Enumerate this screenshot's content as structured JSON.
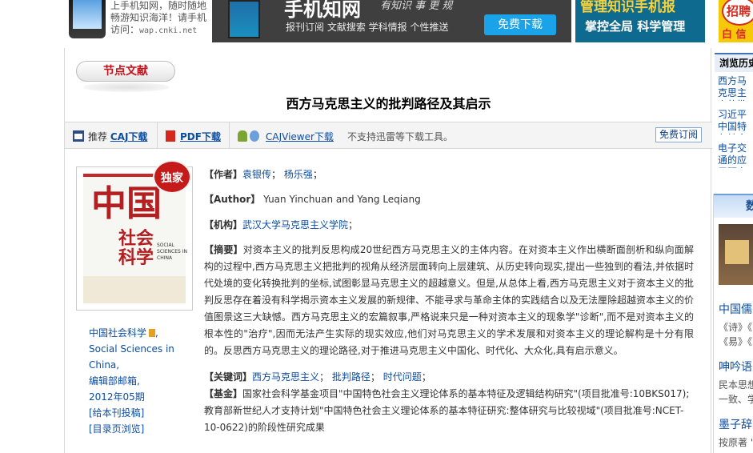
{
  "banner": {
    "phone_ad_lines": [
      "上手机知网，随时随地",
      "畅游知识海洋！请手机",
      "访问："
    ],
    "phone_ad_url": "wap.cnki.net",
    "mid_brand": "手机知网",
    "mid_slogan": "有知识 事 更 规",
    "mid_features": "报刊订阅  文献搜索   学科情报  个性推送",
    "mid_button": "免费下载",
    "right_line1": "管理知识手机报",
    "right_line2": "掌控全局 科学管理",
    "far_text": "招聘",
    "far_sub": "白 信"
  },
  "page": {
    "node_label": "节点文献",
    "title": "西方马克思主义的批判路径及其启示"
  },
  "toolbar": {
    "recommend_label": "推荐",
    "caj_link": "CAJ下载",
    "pdf_link": "PDF下载",
    "cajviewer_link": "CAJViewer下载",
    "notice": "不支持迅雷等下载工具。",
    "subscribe_button": "免费订阅"
  },
  "cover": {
    "big_text": "中国",
    "small_text": "社会\n科学",
    "en_text": "SOCIAL SCIENCES IN CHINA",
    "badge": "独家"
  },
  "journal": {
    "name_cn": "中国社会科学",
    "suffix": ",",
    "name_en_line1": "Social Sciences in",
    "name_en_line2": "China",
    "separator": ",",
    "office": "编辑部邮箱,",
    "issue": "2012年05期",
    "submit": "[给本刊投稿]",
    "toc": "[目录页浏览]"
  },
  "article": {
    "author_label": "【作者】",
    "authors": [
      {
        "name": "袁银传",
        "sep": "；"
      },
      {
        "name": "杨乐强",
        "sep": "；"
      }
    ],
    "author_en_label": "【Author】",
    "author_en": "Yuan Yinchuan and Yang Leqiang",
    "inst_label": "【机构】",
    "institution": "武汉大学马克思主义学院",
    "inst_sep": "；",
    "abstract_label": "【摘要】",
    "abstract": "对资本主义的批判反思构成20世纪西方马克思主义的主体内容。在对资本主义作出横断面剖析和纵向面解构的过程中,西方马克思主义把批判的视角从经济层面转向上层建筑、从历史转向现实,提出一些独到的看法,并依据时代处境的变化转换批判的坐标,试图彰显马克思主义的超越意义。但是,从总体上看,西方马克思主义对于资本主义的批判反思存在着没有科学揭示资本主义发展的新规律、不能寻求与革命主体的实践结合以及无法厘除超越资本主义的价值图景这三大缺憾。西方马克思主义的宏篇叙事,严格说来只是一种对资本主义的现象学\"诊断\",而不是对资本主义的根本性的\"治疗\",因而无法产生实际的现实效应,他们对马克思主义的学术发展和对资本主义的理论解构是十分有限的。反思西方马克思主义的理论路径,对于推进马克思主义中国化、时代化、大众化,具有启示意义。",
    "keywords_label": "【关键词】",
    "keywords": [
      {
        "word": "西方马克思主义",
        "sep": "；"
      },
      {
        "word": "批判路径",
        "sep": "；"
      },
      {
        "word": "时代问题",
        "sep": "；"
      }
    ],
    "fund_label": "【基金】",
    "fund": "国家社会科学基金项目\"中国特色社会主义理论体系的基本特征及逻辑结构研究\"(项目批准号:10BKS017);教育部新世纪人才支持计划\"中国特色社会主义理论体系的基本特征研究:整体研究与比较视域\"(项目批准号:NCET-10-0622)的阶段性研究成果"
  },
  "sidebar": {
    "header": "浏览历史",
    "history": [
      "西方马克思主义的批判路径及其启示",
      "习近平中国特色社会主义思想研究",
      "电子交通的应用研究"
    ],
    "box_header": "数",
    "item1_title": "中国儒",
    "item1_line1": "《诗》《",
    "item1_line2": "《易》《",
    "item2_title": "呻吟语",
    "item2_line1": "民本思想",
    "item2_line2": "一致、学",
    "item3_title": "墨子辞",
    "item3_line1": "按原著 \""
  }
}
